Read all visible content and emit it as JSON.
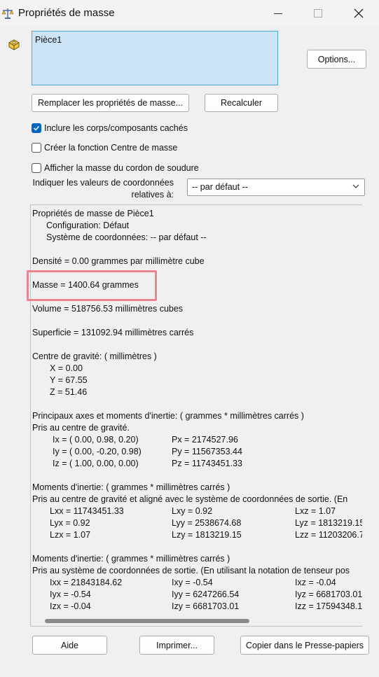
{
  "window": {
    "title": "Propriétés de masse"
  },
  "selection": {
    "items": [
      "Pièce1"
    ]
  },
  "buttons": {
    "options": "Options...",
    "replace": "Remplacer les propriétés de masse...",
    "recalc": "Recalculer",
    "help": "Aide",
    "print": "Imprimer...",
    "copy": "Copier dans le Presse-papiers"
  },
  "checkboxes": [
    {
      "label": "Inclure les corps/composants cachés",
      "checked": true
    },
    {
      "label": "Créer la fonction Centre de masse",
      "checked": false
    },
    {
      "label": "Afficher la masse du cordon de soudure",
      "checked": false
    }
  ],
  "coords": {
    "label_line1": "Indiquer les valeurs de coordonnées",
    "label_line2": "relatives à:",
    "selected": "-- par défaut --"
  },
  "results": {
    "header": "Propriétés de masse de Pièce1",
    "config": "Configuration: Défaut",
    "coord_system": "Système de coordonnées: -- par défaut --",
    "density": "Densité = 0.00 grammes par millimètre cube",
    "mass": "Masse = 1400.64 grammes",
    "volume": "Volume = 518756.53 millimètres cubes",
    "surface": "Superficie = 131092.94  millimètres carrés",
    "cog_title": "Centre de gravité: ( millimètres )",
    "cog": [
      "X = 0.00",
      "Y = 67.55",
      "Z = 51.46"
    ],
    "principal_title": "Principaux axes et moments d'inertie: ( grammes *  millimètres carrés )",
    "principal_sub": "Pris au centre de gravité.",
    "principal_axes": [
      {
        "axis": "Ix = ( 0.00,  0.98,  0.20)",
        "moment": "Px = 2174527.96"
      },
      {
        "axis": "Iy = ( 0.00, -0.20,  0.98)",
        "moment": "Py = 11567353.44"
      },
      {
        "axis": "Iz = ( 1.00,  0.00,  0.00)",
        "moment": "Pz = 11743451.33"
      }
    ],
    "moments_cg_title": "Moments d'inertie: ( grammes *  millimètres carrés )",
    "moments_cg_sub": "Pris au centre de gravité et aligné avec le système de coordonnées de sortie. (En",
    "moments_cg": [
      [
        "Lxx = 11743451.33",
        "Lxy = 0.92",
        "Lxz = 1.07"
      ],
      [
        "Lyx = 0.92",
        "Lyy = 2538674.68",
        "Lyz = 1813219.15"
      ],
      [
        "Lzx = 1.07",
        "Lzy = 1813219.15",
        "Lzz = 11203206.7"
      ]
    ],
    "moments_out_title": "Moments d'inertie: ( grammes *  millimètres carrés )",
    "moments_out_sub": "Pris au système de coordonnées de sortie. (En utilisant la notation de tenseur pos",
    "moments_out": [
      [
        "Ixx = 21843184.62",
        "Ixy = -0.54",
        "Ixz = -0.04"
      ],
      [
        "Iyx = -0.54",
        "Iyy = 6247266.54",
        "Iyz = 6681703.01"
      ],
      [
        "Izx = -0.04",
        "Izy = 6681703.01",
        "Izz = 17594348.1"
      ]
    ]
  }
}
